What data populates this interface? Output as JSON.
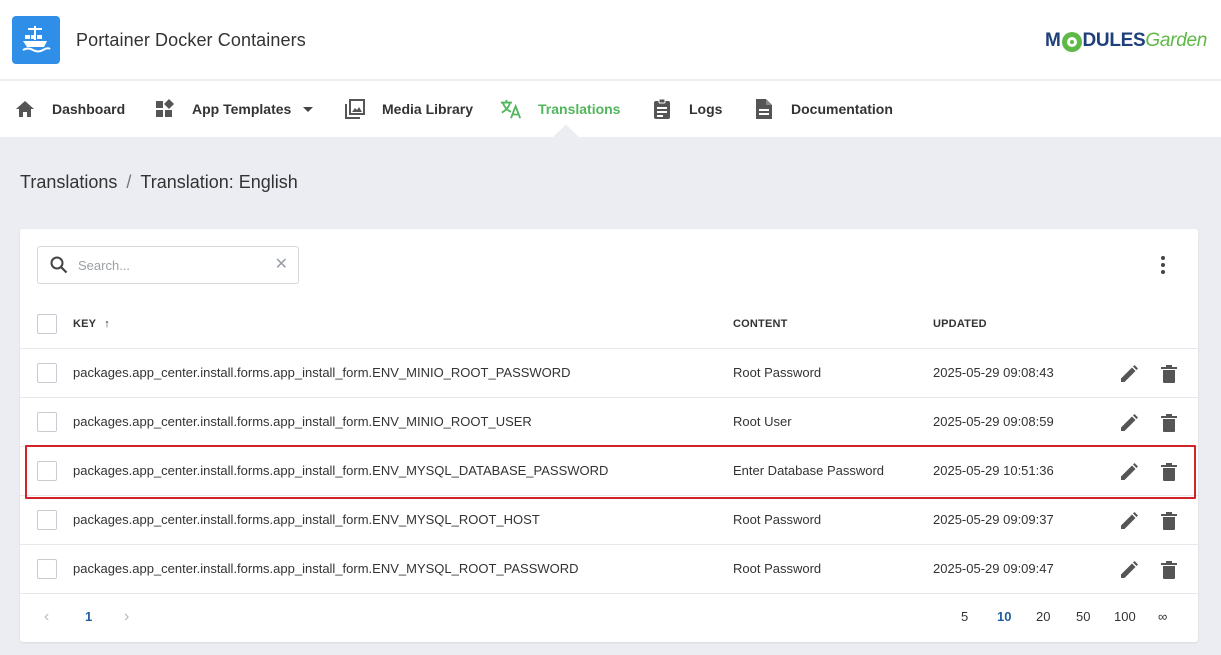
{
  "app": {
    "title": "Portainer Docker Containers",
    "brand_part1": "M",
    "brand_part2": "DULES",
    "brand_part3": "Garden"
  },
  "nav": {
    "dashboard": "Dashboard",
    "app_templates": "App Templates",
    "media_library": "Media Library",
    "translations": "Translations",
    "logs": "Logs",
    "documentation": "Documentation",
    "active": "translations"
  },
  "breadcrumb": {
    "parent": "Translations",
    "separator": "/",
    "current": "Translation: English"
  },
  "search": {
    "placeholder": "Search...",
    "value": ""
  },
  "table": {
    "headers": {
      "key": "KEY",
      "content": "CONTENT",
      "updated": "UPDATED",
      "sort_indicator": "↑"
    },
    "rows": [
      {
        "key": "packages.app_center.install.forms.app_install_form.ENV_MINIO_ROOT_PASSWORD",
        "content": "Root Password",
        "updated": "2025-05-29 09:08:43"
      },
      {
        "key": "packages.app_center.install.forms.app_install_form.ENV_MINIO_ROOT_USER",
        "content": "Root User",
        "updated": "2025-05-29 09:08:59"
      },
      {
        "key": "packages.app_center.install.forms.app_install_form.ENV_MYSQL_DATABASE_PASSWORD",
        "content": "Enter Database Password",
        "updated": "2025-05-29 10:51:36"
      },
      {
        "key": "packages.app_center.install.forms.app_install_form.ENV_MYSQL_ROOT_HOST",
        "content": "Root Password",
        "updated": "2025-05-29 09:09:37"
      },
      {
        "key": "packages.app_center.install.forms.app_install_form.ENV_MYSQL_ROOT_PASSWORD",
        "content": "Root Password",
        "updated": "2025-05-29 09:09:47"
      }
    ],
    "highlighted_row": 2
  },
  "pagination": {
    "current_page": "1",
    "prev": "‹",
    "next": "›",
    "page_sizes": [
      "5",
      "10",
      "20",
      "50",
      "100",
      "∞"
    ],
    "active_page_size": "10"
  },
  "colors": {
    "accent": "#52b65c",
    "app_icon_bg": "#2f8ee8",
    "highlight_border": "#d2232a",
    "pager_active": "#1f5fa0"
  }
}
